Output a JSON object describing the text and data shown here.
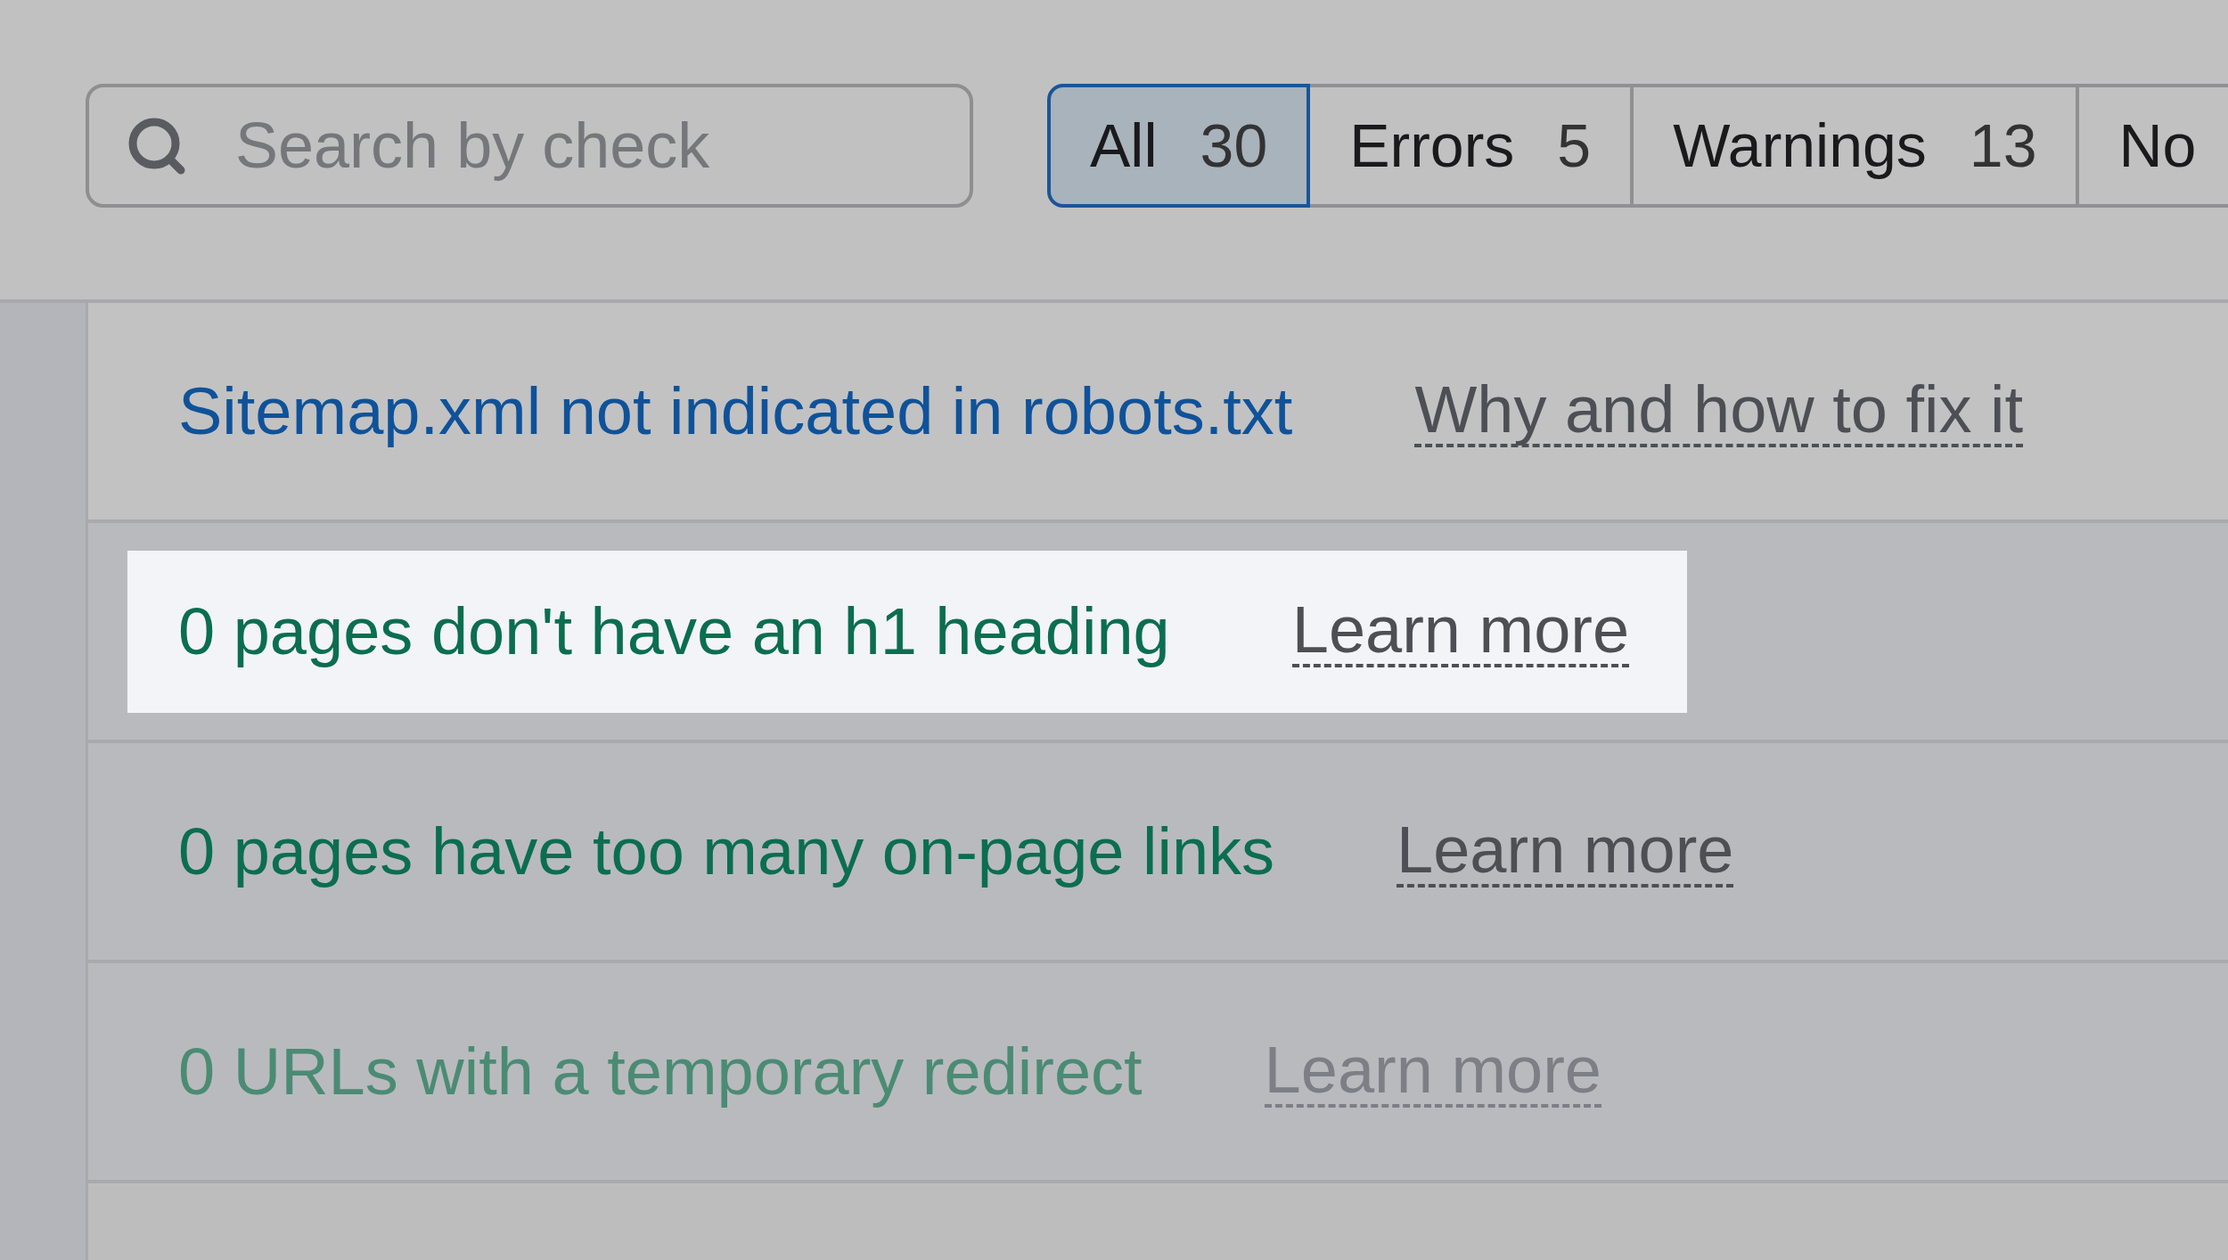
{
  "search": {
    "placeholder": "Search by check"
  },
  "tabs": [
    {
      "label": "All",
      "count": "30",
      "selected": true
    },
    {
      "label": "Errors",
      "count": "5",
      "selected": false
    },
    {
      "label": "Warnings",
      "count": "13",
      "selected": false
    },
    {
      "label": "No",
      "selected": false
    }
  ],
  "checks": [
    {
      "kind": "issue",
      "title": "Sitemap.xml not indicated in robots.txt",
      "link": "Why and how to fix it",
      "highlighted": false,
      "dimmed": false
    },
    {
      "kind": "passed",
      "title": "0 pages don't have an h1 heading",
      "link": "Learn more",
      "highlighted": true,
      "dimmed": false
    },
    {
      "kind": "passed",
      "title": "0 pages have too many on-page links",
      "link": "Learn more",
      "highlighted": false,
      "dimmed": false
    },
    {
      "kind": "passed",
      "title": "0 URLs with a temporary redirect",
      "link": "Learn more",
      "highlighted": false,
      "dimmed": true
    }
  ]
}
